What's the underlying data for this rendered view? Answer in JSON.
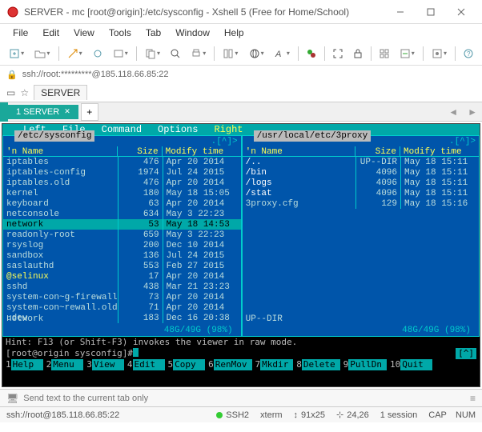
{
  "window": {
    "title": "SERVER - mc [root@origin]:/etc/sysconfig - Xshell 5 (Free for Home/School)"
  },
  "menu": {
    "file": "File",
    "edit": "Edit",
    "view": "View",
    "tools": "Tools",
    "tab": "Tab",
    "window": "Window",
    "help": "Help"
  },
  "address": "ssh://root:*********@185.118.66.85:22",
  "sessionTab": "SERVER",
  "mainTab": "1 SERVER",
  "mc": {
    "top": {
      "left": "Left",
      "file": "File",
      "command": "Command",
      "options": "Options",
      "right": "Right"
    },
    "leftPanel": {
      "path": "/etc/sysconfig",
      "topRight": ".[^]>",
      "cols": {
        "name": "'n     Name",
        "size": "Size",
        "mod": "Modify time"
      },
      "rows": [
        {
          "name": " iptables",
          "size": "476",
          "mod": "Apr 20  2014"
        },
        {
          "name": " iptables-config",
          "size": "1974",
          "mod": "Jul 24  2015"
        },
        {
          "name": " iptables.old",
          "size": "476",
          "mod": "Apr 20  2014"
        },
        {
          "name": " kernel",
          "size": "180",
          "mod": "May 18 15:05"
        },
        {
          "name": " keyboard",
          "size": "63",
          "mod": "Apr 20  2014"
        },
        {
          "name": " netconsole",
          "size": "634",
          "mod": "May  3 22:23"
        },
        {
          "name": " network",
          "size": "53",
          "mod": "May 18 14:53",
          "sel": true
        },
        {
          "name": " readonly-root",
          "size": "659",
          "mod": "May  3 22:23"
        },
        {
          "name": " rsyslog",
          "size": "200",
          "mod": "Dec 10  2014"
        },
        {
          "name": " sandbox",
          "size": "136",
          "mod": "Jul 24  2015"
        },
        {
          "name": " saslauthd",
          "size": "553",
          "mod": "Feb 27  2015"
        },
        {
          "name": "@selinux",
          "size": "17",
          "mod": "Apr 20  2014",
          "hl": true
        },
        {
          "name": " sshd",
          "size": "438",
          "mod": "Mar 21 23:23"
        },
        {
          "name": " system-con~g-firewall",
          "size": "73",
          "mod": "Apr 20  2014"
        },
        {
          "name": " system-con~rewall.old",
          "size": "71",
          "mod": "Apr 20  2014"
        },
        {
          "name": " udev",
          "size": "183",
          "mod": "Dec 16 20:38"
        }
      ],
      "footer": "network",
      "stats": "48G/49G (98%)"
    },
    "rightPanel": {
      "path": "/usr/local/etc/3proxy",
      "topRight": ".[^]>",
      "cols": {
        "name": "'n     Name",
        "size": "Size",
        "mod": "Modify time"
      },
      "rows": [
        {
          "name": "/..",
          "size": "UP--DIR",
          "mod": "May 18 15:11",
          "dir": true
        },
        {
          "name": "/bin",
          "size": "4096",
          "mod": "May 18 15:11",
          "dir": true
        },
        {
          "name": "/logs",
          "size": "4096",
          "mod": "May 18 15:11",
          "dir": true
        },
        {
          "name": "/stat",
          "size": "4096",
          "mod": "May 18 15:11",
          "dir": true
        },
        {
          "name": " 3proxy.cfg",
          "size": "129",
          "mod": "May 18 15:16"
        }
      ],
      "footer": "UP--DIR",
      "stats": "48G/49G (98%)"
    },
    "hint": "Hint: F13 (or Shift-F3) invokes the viewer in raw mode.",
    "prompt": "[root@origin sysconfig]# ",
    "eol": "[^]",
    "fkeys": [
      {
        "n": "1",
        "l": "Help"
      },
      {
        "n": "2",
        "l": "Menu"
      },
      {
        "n": "3",
        "l": "View"
      },
      {
        "n": "4",
        "l": "Edit"
      },
      {
        "n": "5",
        "l": "Copy"
      },
      {
        "n": "6",
        "l": "RenMov"
      },
      {
        "n": "7",
        "l": "Mkdir"
      },
      {
        "n": "8",
        "l": "Delete"
      },
      {
        "n": "9",
        "l": "PullDn"
      },
      {
        "n": "10",
        "l": "Quit"
      }
    ]
  },
  "sendText": {
    "placeholder": "Send text to the current tab only"
  },
  "status": {
    "conn": "ssh://root@185.118.66.85:22",
    "ssh": "SSH2",
    "term": "xterm",
    "size": "91x25",
    "pos": "24,26",
    "sess": "1 session",
    "cap": "CAP",
    "num": "NUM"
  }
}
